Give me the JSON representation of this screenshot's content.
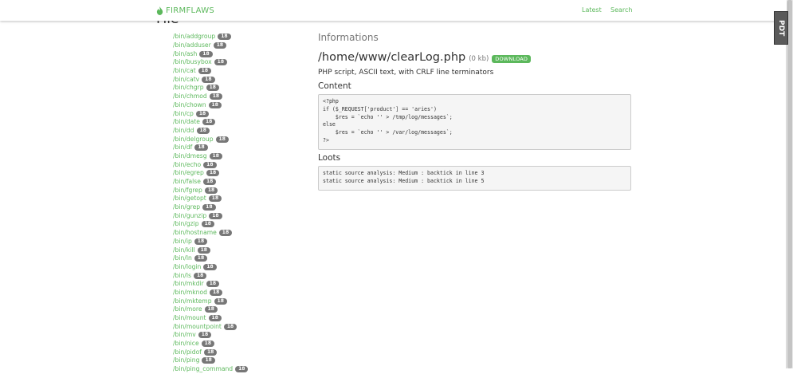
{
  "nav": {
    "brand": "FIRMFLAWS",
    "links": [
      "Latest",
      "Search"
    ]
  },
  "side_badge": "PDT",
  "sidebar": {
    "heading": "File",
    "items": [
      {
        "path": "/bin/addgroup",
        "count": "18"
      },
      {
        "path": "/bin/adduser",
        "count": "18"
      },
      {
        "path": "/bin/ash",
        "count": "18"
      },
      {
        "path": "/bin/busybox",
        "count": "18"
      },
      {
        "path": "/bin/cat",
        "count": "18"
      },
      {
        "path": "/bin/catv",
        "count": "18"
      },
      {
        "path": "/bin/chgrp",
        "count": "18"
      },
      {
        "path": "/bin/chmod",
        "count": "18"
      },
      {
        "path": "/bin/chown",
        "count": "18"
      },
      {
        "path": "/bin/cp",
        "count": "18"
      },
      {
        "path": "/bin/date",
        "count": "18"
      },
      {
        "path": "/bin/dd",
        "count": "18"
      },
      {
        "path": "/bin/delgroup",
        "count": "18"
      },
      {
        "path": "/bin/df",
        "count": "18"
      },
      {
        "path": "/bin/dmesg",
        "count": "18"
      },
      {
        "path": "/bin/echo",
        "count": "18"
      },
      {
        "path": "/bin/egrep",
        "count": "18"
      },
      {
        "path": "/bin/false",
        "count": "18"
      },
      {
        "path": "/bin/fgrep",
        "count": "18"
      },
      {
        "path": "/bin/getopt",
        "count": "18"
      },
      {
        "path": "/bin/grep",
        "count": "18"
      },
      {
        "path": "/bin/gunzip",
        "count": "18"
      },
      {
        "path": "/bin/gzip",
        "count": "18"
      },
      {
        "path": "/bin/hostname",
        "count": "18"
      },
      {
        "path": "/bin/ip",
        "count": "18"
      },
      {
        "path": "/bin/kill",
        "count": "18"
      },
      {
        "path": "/bin/ln",
        "count": "18"
      },
      {
        "path": "/bin/login",
        "count": "18"
      },
      {
        "path": "/bin/ls",
        "count": "18"
      },
      {
        "path": "/bin/mkdir",
        "count": "18"
      },
      {
        "path": "/bin/mknod",
        "count": "18"
      },
      {
        "path": "/bin/mktemp",
        "count": "18"
      },
      {
        "path": "/bin/more",
        "count": "18"
      },
      {
        "path": "/bin/mount",
        "count": "18"
      },
      {
        "path": "/bin/mountpoint",
        "count": "18"
      },
      {
        "path": "/bin/mv",
        "count": "18"
      },
      {
        "path": "/bin/nice",
        "count": "18"
      },
      {
        "path": "/bin/pidof",
        "count": "18"
      },
      {
        "path": "/bin/ping",
        "count": "18"
      },
      {
        "path": "/bin/ping_command",
        "count": "18"
      }
    ]
  },
  "main": {
    "informations_heading": "Informations",
    "file_path": "/home/www/clearLog.php",
    "file_size": "(0 kb)",
    "download_label": "DOWNLOAD",
    "file_type": "PHP script, ASCII text, with CRLF line terminators",
    "content_heading": "Content",
    "code_lines": [
      "<?php",
      "if ($_REQUEST['product'] == 'aries')",
      "    $res = `echo '' > /tmp/log/messages`;",
      "else",
      "    $res = `echo '' > /var/log/messages`;",
      "?>"
    ],
    "loots_heading": "Loots",
    "loots_lines": [
      "static source analysis: Medium : backtick in line 3",
      "static source analysis: Medium : backtick in line 5"
    ]
  },
  "colors": {
    "accent": "#5cb85c",
    "badge": "#777777",
    "code_bg": "#f5f5f5"
  }
}
